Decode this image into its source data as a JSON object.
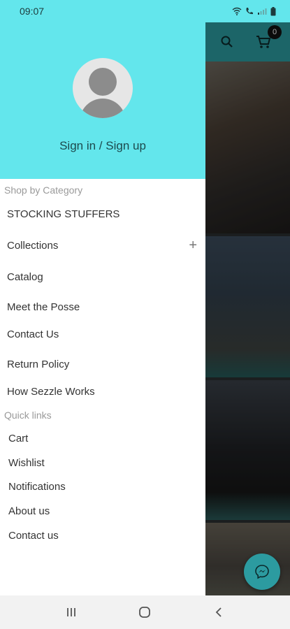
{
  "status_bar": {
    "time": "09:07"
  },
  "toolbar": {
    "cart_count": "0"
  },
  "drawer": {
    "sign_in_label": "Sign in / Sign up",
    "category_heading": "Shop by Category",
    "categories": [
      {
        "label": "STOCKING STUFFERS"
      },
      {
        "label": "Collections",
        "expand": "+"
      },
      {
        "label": "Catalog"
      },
      {
        "label": "Meet the Posse"
      },
      {
        "label": "Contact Us"
      },
      {
        "label": "Return Policy"
      },
      {
        "label": "How Sezzle Works"
      }
    ],
    "quick_links_heading": "Quick links",
    "quick_links": [
      {
        "label": "Cart"
      },
      {
        "label": "Wishlist"
      },
      {
        "label": "Notifications"
      },
      {
        "label": "About us"
      },
      {
        "label": "Contact us"
      }
    ]
  },
  "colors": {
    "accent": "#63e6ec",
    "toolbar": "#2c9ba0",
    "text": "#333333",
    "muted": "#9a9a9a"
  },
  "icons": {
    "search": "search-icon",
    "cart": "cart-icon",
    "messenger": "messenger-icon",
    "avatar": "avatar-icon"
  }
}
